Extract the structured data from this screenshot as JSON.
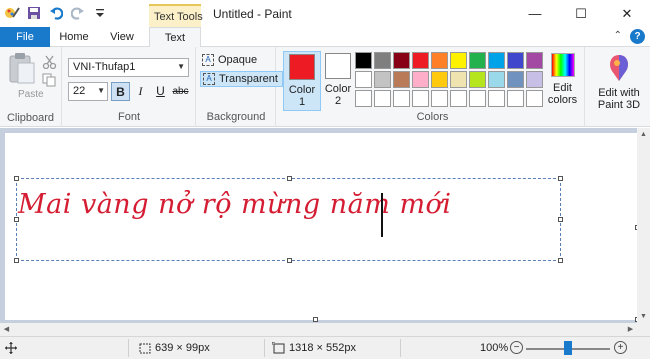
{
  "window": {
    "title": "Untitled - Paint",
    "context_tab": "Text Tools",
    "minimize_glyph": "—",
    "maximize_glyph": "☐",
    "close_glyph": "✕"
  },
  "tabs": {
    "file": "File",
    "home": "Home",
    "view": "View",
    "text": "Text"
  },
  "ribbon": {
    "clipboard": {
      "group_label": "Clipboard",
      "paste_label": "Paste"
    },
    "font": {
      "group_label": "Font",
      "family": "VNI-Thufap1",
      "size": "22",
      "bold": "B",
      "italic": "I",
      "underline": "U",
      "strikethrough": "abc",
      "active_format": "bold"
    },
    "background": {
      "group_label": "Background",
      "opaque": "Opaque",
      "transparent": "Transparent",
      "selected": "transparent"
    },
    "colors": {
      "group_label": "Colors",
      "color1_label": "Color 1",
      "color1_value": "#ed1c24",
      "color2_label": "Color 2",
      "color2_value": "#ffffff",
      "palette": [
        "#000000",
        "#7f7f7f",
        "#880015",
        "#ed1c24",
        "#ff7f27",
        "#fff200",
        "#22b14c",
        "#00a2e8",
        "#3f48cc",
        "#a349a4",
        "#ffffff",
        "#c3c3c3",
        "#b97a57",
        "#ffaec9",
        "#ffc90e",
        "#efe4b0",
        "#b5e61d",
        "#99d9ea",
        "#7092be",
        "#c8bfe7",
        "#ffffff",
        "#ffffff",
        "#ffffff",
        "#ffffff",
        "#ffffff",
        "#ffffff",
        "#ffffff",
        "#ffffff",
        "#ffffff",
        "#ffffff"
      ],
      "edit_colors": "Edit colors"
    },
    "paint3d": {
      "label": "Edit with Paint 3D"
    }
  },
  "canvas": {
    "text": "Mai vàng nở rộ mừng năm mới",
    "text_color": "#d41c32"
  },
  "status": {
    "selection_size": "639 × 99px",
    "image_size": "1318 × 552px",
    "zoom": "100%",
    "zoom_fraction": 0.5
  }
}
